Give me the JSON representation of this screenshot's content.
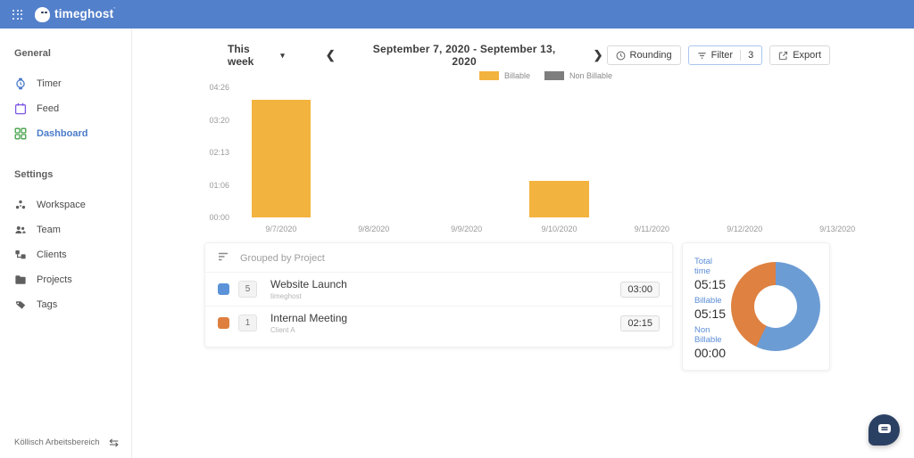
{
  "header": {
    "logo": "timeghost"
  },
  "sidebar": {
    "sections": [
      {
        "label": "General",
        "items": [
          {
            "label": "Timer",
            "icon": "watch-icon",
            "color": "#4a7bc9"
          },
          {
            "label": "Feed",
            "icon": "calendar-icon",
            "color": "#7e57e8"
          },
          {
            "label": "Dashboard",
            "icon": "dashboard-grid-icon",
            "color": "#43A047",
            "active": true
          }
        ]
      },
      {
        "label": "Settings",
        "items": [
          {
            "label": "Workspace",
            "icon": "workspace-dots-icon",
            "color": "#5f5f5f"
          },
          {
            "label": "Team",
            "icon": "team-icon",
            "color": "#5f5f5f"
          },
          {
            "label": "Clients",
            "icon": "clients-icon",
            "color": "#5f5f5f"
          },
          {
            "label": "Projects",
            "icon": "folder-icon",
            "color": "#5f5f5f"
          },
          {
            "label": "Tags",
            "icon": "tag-icon",
            "color": "#5f5f5f"
          }
        ]
      }
    ],
    "workspace": {
      "name": "Köllisch Arbeitsbereich",
      "switch_icon": "swap-arrows-icon"
    }
  },
  "toolbar": {
    "preset": "This week",
    "date_range": "September 7, 2020 - September 13, 2020",
    "rounding_label": "Rounding",
    "filter_label": "Filter",
    "filter_count": "3",
    "export_label": "Export"
  },
  "chart_data": [
    {
      "type": "bar",
      "title": "Weekly time per day",
      "categories": [
        "9/7/2020",
        "9/8/2020",
        "9/9/2020",
        "9/10/2020",
        "9/11/2020",
        "9/12/2020",
        "9/13/2020"
      ],
      "series": [
        {
          "name": "Billable",
          "color": "#F3B33F",
          "values_minutes": [
            240,
            0,
            0,
            75,
            0,
            0,
            0
          ]
        },
        {
          "name": "Non Billable",
          "color": "#7E7E7E",
          "values_minutes": [
            0,
            0,
            0,
            0,
            0,
            0,
            0
          ]
        }
      ],
      "yticks": [
        "00:00",
        "01:06",
        "02:13",
        "03:20",
        "04:26"
      ],
      "ylim_minutes": [
        0,
        266
      ],
      "legend": [
        "Billable",
        "Non Billable"
      ],
      "legend_position": "top",
      "grid": false
    },
    {
      "type": "pie",
      "title": "Billable vs projects donut",
      "slices": [
        {
          "label": "Website Launch",
          "minutes": 180,
          "color": "#6C9CD4"
        },
        {
          "label": "Internal Meeting",
          "minutes": 135,
          "color": "#DE8141"
        }
      ]
    }
  ],
  "grouped": {
    "title": "Grouped by Project",
    "rows": [
      {
        "count": "5",
        "name": "Website Launch",
        "client": "timeghost",
        "duration": "03:00",
        "color": "#5C93D8"
      },
      {
        "count": "1",
        "name": "Internal Meeting",
        "client": "Client A",
        "duration": "02:15",
        "color": "#DE7F3F"
      }
    ]
  },
  "summary": {
    "total_label": "Total time",
    "total_value": "05:15",
    "billable_label": "Billable",
    "billable_value": "05:15",
    "nonbillable_label": "Non Billable",
    "nonbillable_value": "00:00"
  },
  "colors": {
    "header_blue": "#5380CB",
    "accent_blue": "#4a7bc9",
    "billable_amber": "#F3B33F",
    "nonbillable_gray": "#7E7E7E",
    "donut_blue": "#6C9CD4",
    "donut_orange": "#DE8141",
    "chat_navy": "#2B4163"
  }
}
